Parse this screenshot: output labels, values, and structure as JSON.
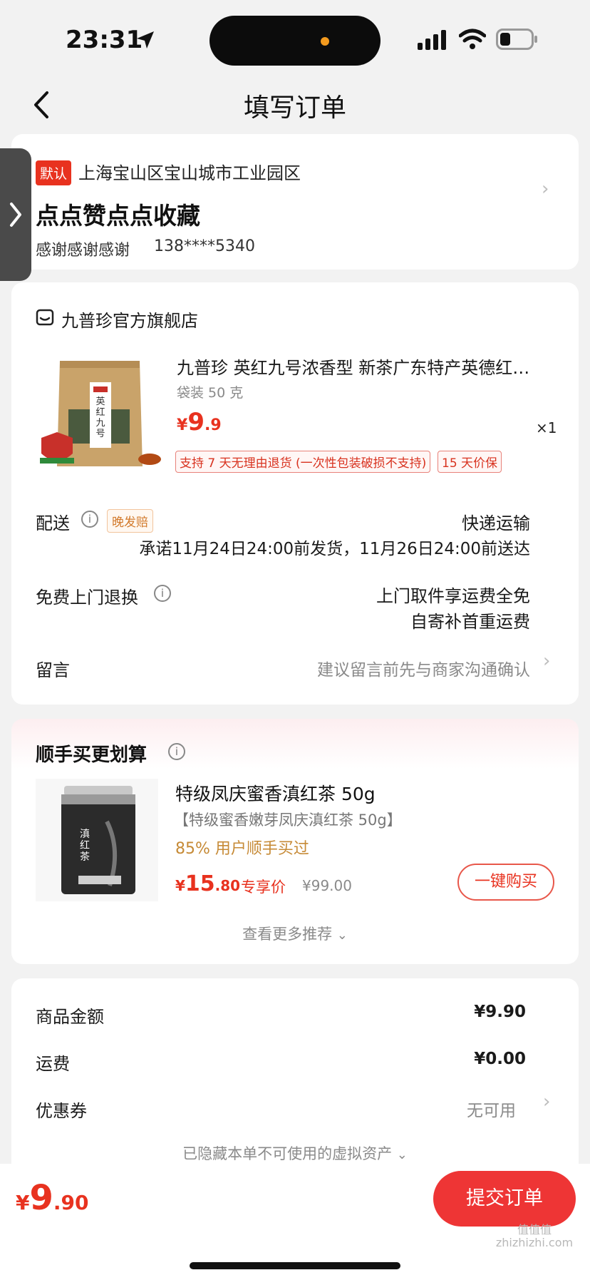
{
  "status_bar": {
    "time": "23:31"
  },
  "header": {
    "title": "填写订单"
  },
  "address": {
    "default_badge": "默认",
    "region": "上海宝山区宝山城市工业园区",
    "detail": "点点赞点点收藏",
    "name": "感谢感谢感谢",
    "phone": "138****5340"
  },
  "store": {
    "name": "九普珍官方旗舰店",
    "product": {
      "title": "九普珍 英红九号浓香型 新茶广东特产英德红…",
      "spec": "袋装 50 克",
      "price_symbol": "¥",
      "price_int": "9",
      "price_dec": ".9",
      "quantity": "×1",
      "tags": [
        "支持 7 天无理由退货 (一次性包装破损不支持)",
        "15 天价保"
      ],
      "image_text": "英红九号"
    },
    "delivery": {
      "label": "配送",
      "badge": "晚发赔",
      "method": "快递运输",
      "promise": "承诺11月24日24:00前发货，11月26日24:00前送达"
    },
    "return_service": {
      "label": "免费上门退换",
      "line1": "上门取件享运费全免",
      "line2": "自寄补首重运费"
    },
    "message": {
      "label": "留言",
      "placeholder": "建议留言前先与商家沟通确认"
    }
  },
  "upsell": {
    "title": "顺手买更划算",
    "product_title": "特级凤庆蜜香滇红茶 50g",
    "subtitle": "【特级蜜香嫩芽凤庆滇红茶 50g】",
    "bought_note": "85% 用户顺手买过",
    "price_symbol": "¥",
    "price_int": "15",
    "price_dec": ".80",
    "price_label": "专享价",
    "original_price": "¥99.00",
    "buy_button": "一键购买",
    "more_link": "查看更多推荐",
    "image_text": "滇红茶"
  },
  "summary": {
    "rows": [
      {
        "label": "商品金额",
        "value": "¥9.90"
      },
      {
        "label": "运费",
        "value": "¥0.00"
      },
      {
        "label": "优惠券",
        "value": "无可用"
      }
    ],
    "hidden_note": "已隐藏本单不可使用的虚拟资产"
  },
  "footer": {
    "price_symbol": "¥",
    "price_int": "9",
    "price_dec": ".90",
    "submit": "提交订单",
    "watermark": "值值值 zhizhizhi.com"
  },
  "colors": {
    "accent": "#e8321f",
    "submit_bg": "#ee3535"
  }
}
